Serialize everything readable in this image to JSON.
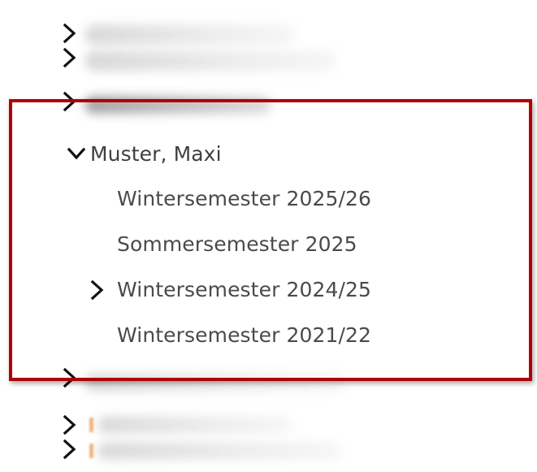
{
  "tree": {
    "parent": {
      "label": "Muster, Maxi",
      "expanded": true,
      "children": [
        {
          "label": "Wintersemester 2025/26",
          "expandable": false
        },
        {
          "label": "Sommersemester 2025",
          "expandable": false
        },
        {
          "label": "Wintersemester 2024/25",
          "expandable": true
        },
        {
          "label": "Wintersemester 2021/22",
          "expandable": false
        }
      ]
    }
  },
  "colors": {
    "highlight_border": "#b00000",
    "text": "#4a4a4a",
    "chevron": "#111111",
    "blurred_accent": "#f2b27a"
  },
  "icons": {
    "collapsed": "chevron-right-icon",
    "expanded": "chevron-down-icon"
  }
}
